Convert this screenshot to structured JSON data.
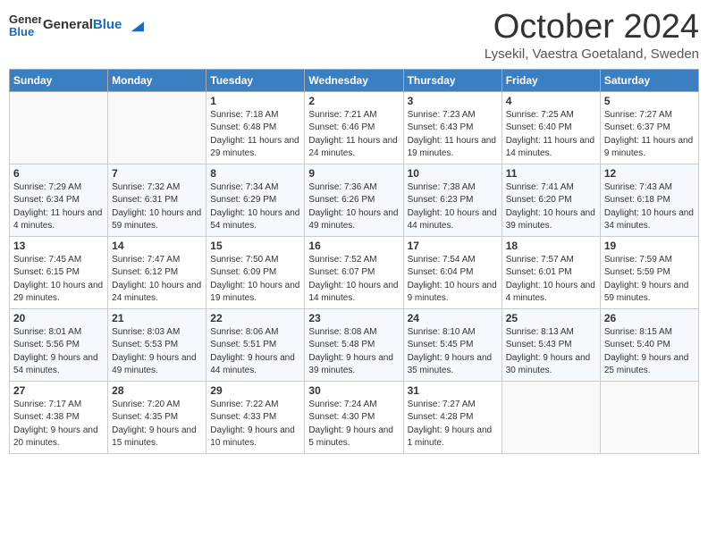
{
  "header": {
    "logo_general": "General",
    "logo_blue": "Blue",
    "title": "October 2024",
    "location": "Lysekil, Vaestra Goetaland, Sweden"
  },
  "columns": [
    "Sunday",
    "Monday",
    "Tuesday",
    "Wednesday",
    "Thursday",
    "Friday",
    "Saturday"
  ],
  "weeks": [
    [
      {
        "day": "",
        "info": ""
      },
      {
        "day": "",
        "info": ""
      },
      {
        "day": "1",
        "info": "Sunrise: 7:18 AM\nSunset: 6:48 PM\nDaylight: 11 hours and 29 minutes."
      },
      {
        "day": "2",
        "info": "Sunrise: 7:21 AM\nSunset: 6:46 PM\nDaylight: 11 hours and 24 minutes."
      },
      {
        "day": "3",
        "info": "Sunrise: 7:23 AM\nSunset: 6:43 PM\nDaylight: 11 hours and 19 minutes."
      },
      {
        "day": "4",
        "info": "Sunrise: 7:25 AM\nSunset: 6:40 PM\nDaylight: 11 hours and 14 minutes."
      },
      {
        "day": "5",
        "info": "Sunrise: 7:27 AM\nSunset: 6:37 PM\nDaylight: 11 hours and 9 minutes."
      }
    ],
    [
      {
        "day": "6",
        "info": "Sunrise: 7:29 AM\nSunset: 6:34 PM\nDaylight: 11 hours and 4 minutes."
      },
      {
        "day": "7",
        "info": "Sunrise: 7:32 AM\nSunset: 6:31 PM\nDaylight: 10 hours and 59 minutes."
      },
      {
        "day": "8",
        "info": "Sunrise: 7:34 AM\nSunset: 6:29 PM\nDaylight: 10 hours and 54 minutes."
      },
      {
        "day": "9",
        "info": "Sunrise: 7:36 AM\nSunset: 6:26 PM\nDaylight: 10 hours and 49 minutes."
      },
      {
        "day": "10",
        "info": "Sunrise: 7:38 AM\nSunset: 6:23 PM\nDaylight: 10 hours and 44 minutes."
      },
      {
        "day": "11",
        "info": "Sunrise: 7:41 AM\nSunset: 6:20 PM\nDaylight: 10 hours and 39 minutes."
      },
      {
        "day": "12",
        "info": "Sunrise: 7:43 AM\nSunset: 6:18 PM\nDaylight: 10 hours and 34 minutes."
      }
    ],
    [
      {
        "day": "13",
        "info": "Sunrise: 7:45 AM\nSunset: 6:15 PM\nDaylight: 10 hours and 29 minutes."
      },
      {
        "day": "14",
        "info": "Sunrise: 7:47 AM\nSunset: 6:12 PM\nDaylight: 10 hours and 24 minutes."
      },
      {
        "day": "15",
        "info": "Sunrise: 7:50 AM\nSunset: 6:09 PM\nDaylight: 10 hours and 19 minutes."
      },
      {
        "day": "16",
        "info": "Sunrise: 7:52 AM\nSunset: 6:07 PM\nDaylight: 10 hours and 14 minutes."
      },
      {
        "day": "17",
        "info": "Sunrise: 7:54 AM\nSunset: 6:04 PM\nDaylight: 10 hours and 9 minutes."
      },
      {
        "day": "18",
        "info": "Sunrise: 7:57 AM\nSunset: 6:01 PM\nDaylight: 10 hours and 4 minutes."
      },
      {
        "day": "19",
        "info": "Sunrise: 7:59 AM\nSunset: 5:59 PM\nDaylight: 9 hours and 59 minutes."
      }
    ],
    [
      {
        "day": "20",
        "info": "Sunrise: 8:01 AM\nSunset: 5:56 PM\nDaylight: 9 hours and 54 minutes."
      },
      {
        "day": "21",
        "info": "Sunrise: 8:03 AM\nSunset: 5:53 PM\nDaylight: 9 hours and 49 minutes."
      },
      {
        "day": "22",
        "info": "Sunrise: 8:06 AM\nSunset: 5:51 PM\nDaylight: 9 hours and 44 minutes."
      },
      {
        "day": "23",
        "info": "Sunrise: 8:08 AM\nSunset: 5:48 PM\nDaylight: 9 hours and 39 minutes."
      },
      {
        "day": "24",
        "info": "Sunrise: 8:10 AM\nSunset: 5:45 PM\nDaylight: 9 hours and 35 minutes."
      },
      {
        "day": "25",
        "info": "Sunrise: 8:13 AM\nSunset: 5:43 PM\nDaylight: 9 hours and 30 minutes."
      },
      {
        "day": "26",
        "info": "Sunrise: 8:15 AM\nSunset: 5:40 PM\nDaylight: 9 hours and 25 minutes."
      }
    ],
    [
      {
        "day": "27",
        "info": "Sunrise: 7:17 AM\nSunset: 4:38 PM\nDaylight: 9 hours and 20 minutes."
      },
      {
        "day": "28",
        "info": "Sunrise: 7:20 AM\nSunset: 4:35 PM\nDaylight: 9 hours and 15 minutes."
      },
      {
        "day": "29",
        "info": "Sunrise: 7:22 AM\nSunset: 4:33 PM\nDaylight: 9 hours and 10 minutes."
      },
      {
        "day": "30",
        "info": "Sunrise: 7:24 AM\nSunset: 4:30 PM\nDaylight: 9 hours and 5 minutes."
      },
      {
        "day": "31",
        "info": "Sunrise: 7:27 AM\nSunset: 4:28 PM\nDaylight: 9 hours and 1 minute."
      },
      {
        "day": "",
        "info": ""
      },
      {
        "day": "",
        "info": ""
      }
    ]
  ]
}
